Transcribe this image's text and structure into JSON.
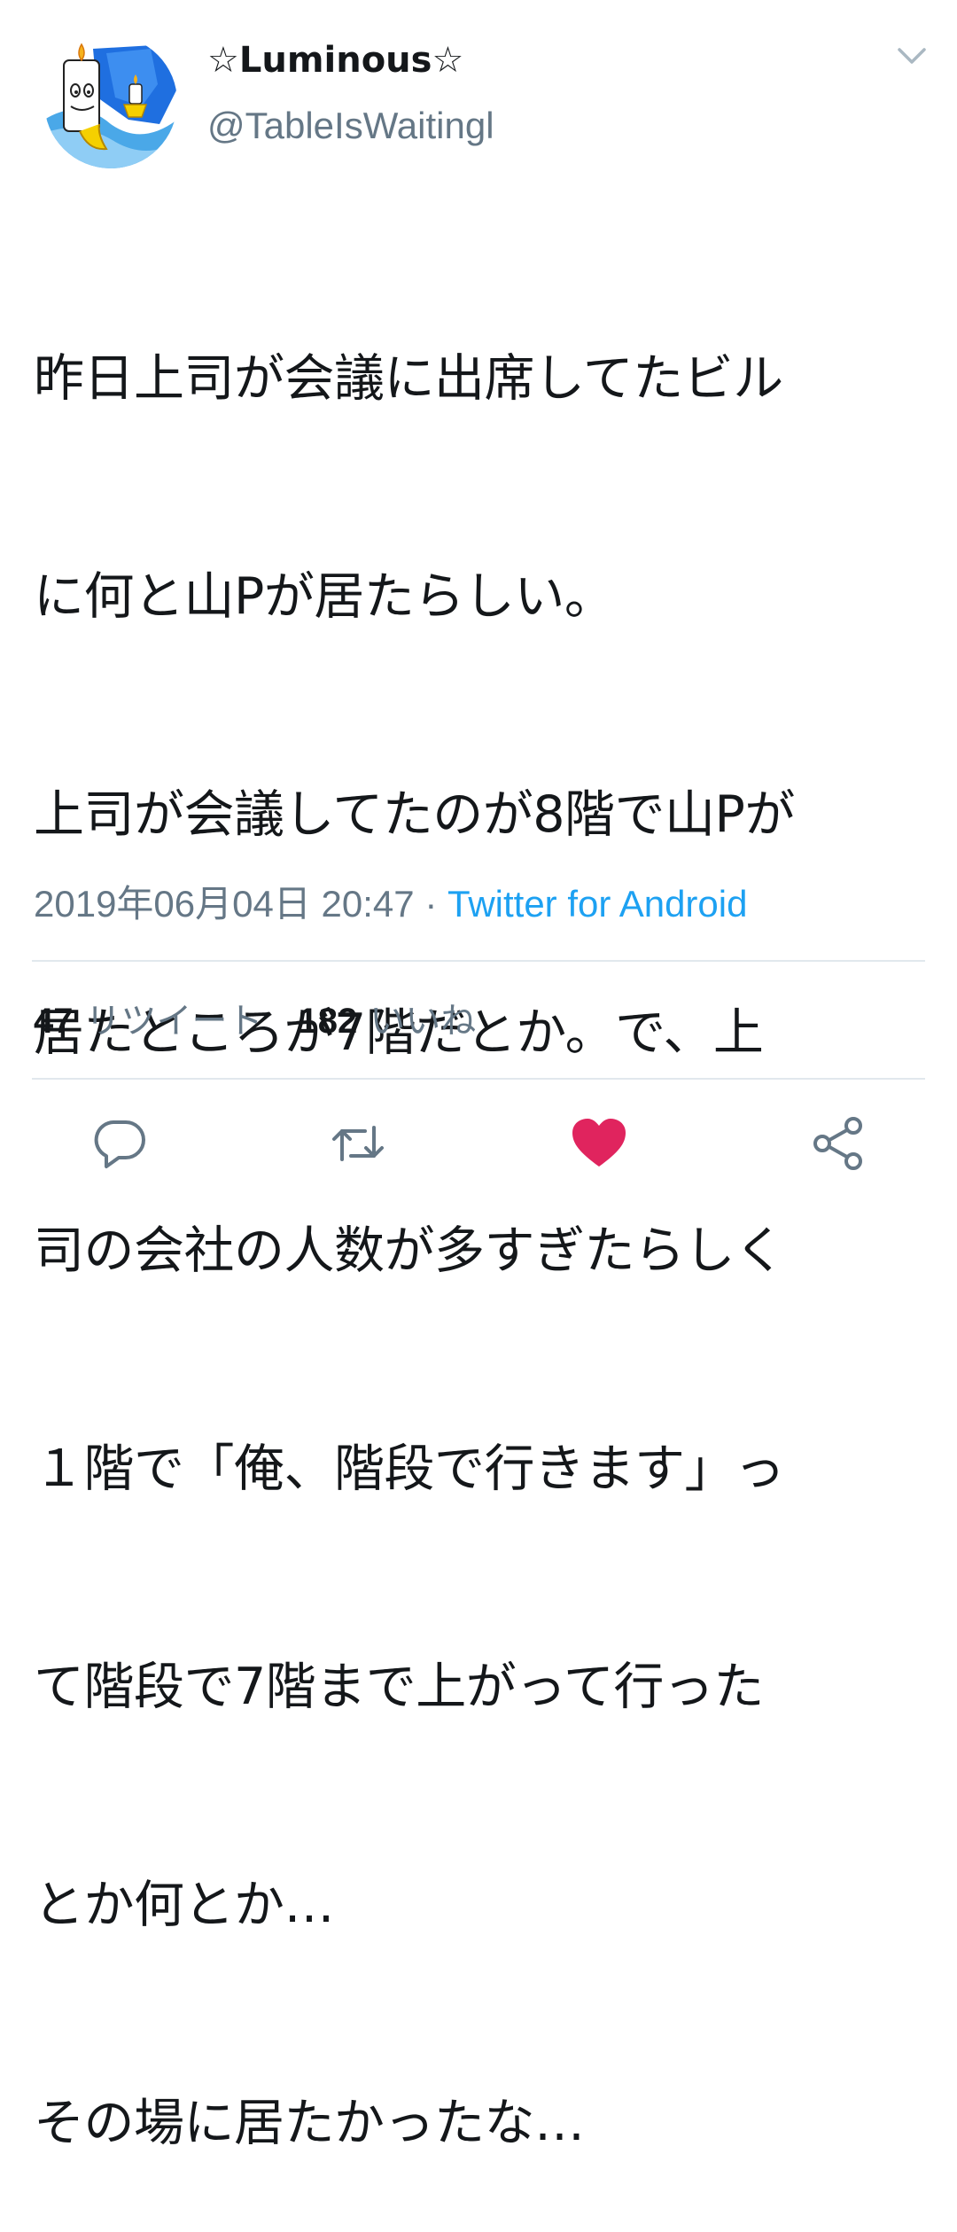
{
  "header": {
    "display_name": "☆Luminous☆",
    "handle": "@TableIsWaitingl",
    "avatar_icon": "candle-character-avatar",
    "menu_icon": "chevron-down-icon"
  },
  "tweet": {
    "lines": [
      "昨日上司が会議に出席してたビル",
      "に何と山Pが居たらしい。",
      "上司が会議してたのが8階で山Pが",
      "居たところが7階だとか。で、上",
      "司の会社の人数が多すぎたらしく",
      "１階で「俺、階段で行きます」っ",
      "て階段で7階まで上がって行った",
      "とか何とか…",
      "その場に居たかったな…"
    ],
    "timestamp": "2019年06月04日 20:47",
    "separator": "·",
    "source": "Twitter for Android"
  },
  "stats": {
    "retweets_count": "47",
    "retweets_label": "リツイート",
    "likes_count": "182",
    "likes_label": "いいね"
  },
  "actions": {
    "reply_icon": "reply-icon",
    "retweet_icon": "retweet-icon",
    "like_icon": "heart-icon",
    "share_icon": "share-icon",
    "like_active": true
  },
  "colors": {
    "text": "#14171a",
    "secondary": "#657786",
    "link": "#1da1f2",
    "like": "#e0245e",
    "divider": "#e1e8ed"
  }
}
